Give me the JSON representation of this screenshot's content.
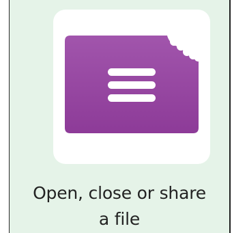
{
  "tile": {
    "label_line1": "Open, close or share",
    "label_line2": "a file",
    "icon": "file-menu-icon"
  },
  "colors": {
    "background": "#e5f3e8",
    "card": "#ffffff",
    "icon_purple": "#9b47a6",
    "icon_purple_dark": "#7e2f88",
    "text": "#222222"
  }
}
